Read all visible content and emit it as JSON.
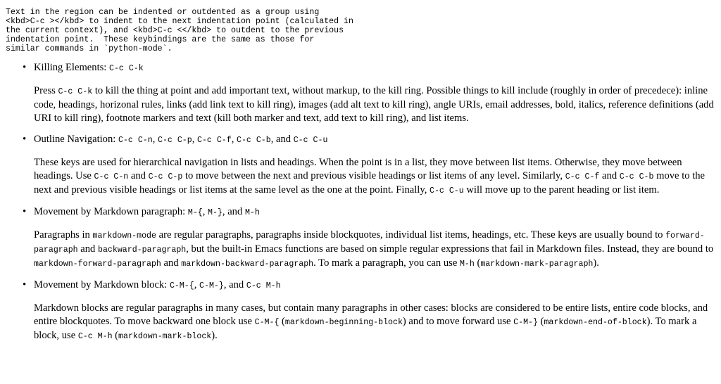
{
  "intro_text": "Text in the region can be indented or outdented as a group using\n<kbd>C-c ></kbd> to indent to the next indentation point (calculated in\nthe current context), and <kbd>C-c <</kbd> to outdent to the previous\nindentation point.  These keybindings are the same as those for\nsimilar commands in `python-mode`.",
  "items": [
    {
      "title": [
        {
          "t": "Killing Elements: "
        },
        {
          "c": "C-c C-k"
        }
      ],
      "body": [
        {
          "t": "Press "
        },
        {
          "c": "C-c C-k"
        },
        {
          "t": " to kill the thing at point and add important text, without markup, to the kill ring. Possible things to kill include (roughly in order of precedece): inline code, headings, horizonal rules, links (add link text to kill ring), images (add alt text to kill ring), angle URIs, email addresses, bold, italics, reference definitions (add URI to kill ring), footnote markers and text (kill both marker and text, add text to kill ring), and list items."
        }
      ]
    },
    {
      "title": [
        {
          "t": "Outline Navigation: "
        },
        {
          "c": "C-c C-n"
        },
        {
          "t": ", "
        },
        {
          "c": "C-c C-p"
        },
        {
          "t": ", "
        },
        {
          "c": "C-c C-f"
        },
        {
          "t": ", "
        },
        {
          "c": "C-c C-b"
        },
        {
          "t": ", and "
        },
        {
          "c": "C-c C-u"
        }
      ],
      "body": [
        {
          "t": "These keys are used for hierarchical navigation in lists and headings. When the point is in a list, they move between list items. Otherwise, they move between headings. Use "
        },
        {
          "c": "C-c C-n"
        },
        {
          "t": " and "
        },
        {
          "c": "C-c C-p"
        },
        {
          "t": " to move between the next and previous visible headings or list items of any level. Similarly, "
        },
        {
          "c": "C-c C-f"
        },
        {
          "t": " and "
        },
        {
          "c": "C-c C-b"
        },
        {
          "t": " move to the next and previous visible headings or list items at the same level as the one at the point. Finally, "
        },
        {
          "c": "C-c C-u"
        },
        {
          "t": " will move up to the parent heading or list item."
        }
      ]
    },
    {
      "title": [
        {
          "t": "Movement by Markdown paragraph: "
        },
        {
          "c": "M-{"
        },
        {
          "t": ", "
        },
        {
          "c": "M-}"
        },
        {
          "t": ", and "
        },
        {
          "c": "M-h"
        }
      ],
      "body": [
        {
          "t": "Paragraphs in "
        },
        {
          "c": "markdown-mode"
        },
        {
          "t": " are regular paragraphs, paragraphs inside blockquotes, individual list items, headings, etc. These keys are usually bound to "
        },
        {
          "c": "forward-paragraph"
        },
        {
          "t": " and "
        },
        {
          "c": "backward-paragraph"
        },
        {
          "t": ", but the built-in Emacs functions are based on simple regular expressions that fail in Markdown files. Instead, they are bound to "
        },
        {
          "c": "markdown-forward-paragraph"
        },
        {
          "t": " and "
        },
        {
          "c": "markdown-backward-paragraph"
        },
        {
          "t": ". To mark a paragraph, you can use "
        },
        {
          "c": "M-h"
        },
        {
          "t": " ("
        },
        {
          "c": "markdown-mark-paragraph"
        },
        {
          "t": ")."
        }
      ]
    },
    {
      "title": [
        {
          "t": "Movement by Markdown block: "
        },
        {
          "c": "C-M-{"
        },
        {
          "t": ", "
        },
        {
          "c": "C-M-}"
        },
        {
          "t": ", and "
        },
        {
          "c": "C-c M-h"
        }
      ],
      "body": [
        {
          "t": "Markdown blocks are regular paragraphs in many cases, but contain many paragraphs in other cases: blocks are considered to be entire lists, entire code blocks, and entire blockquotes. To move backward one block use "
        },
        {
          "c": "C-M-{"
        },
        {
          "t": " ("
        },
        {
          "c": "markdown-beginning-block"
        },
        {
          "t": ") and to move forward use "
        },
        {
          "c": "C-M-}"
        },
        {
          "t": " ("
        },
        {
          "c": "markdown-end-of-block"
        },
        {
          "t": "). To mark a block, use "
        },
        {
          "c": "C-c M-h"
        },
        {
          "t": " ("
        },
        {
          "c": "markdown-mark-block"
        },
        {
          "t": ")."
        }
      ]
    }
  ]
}
